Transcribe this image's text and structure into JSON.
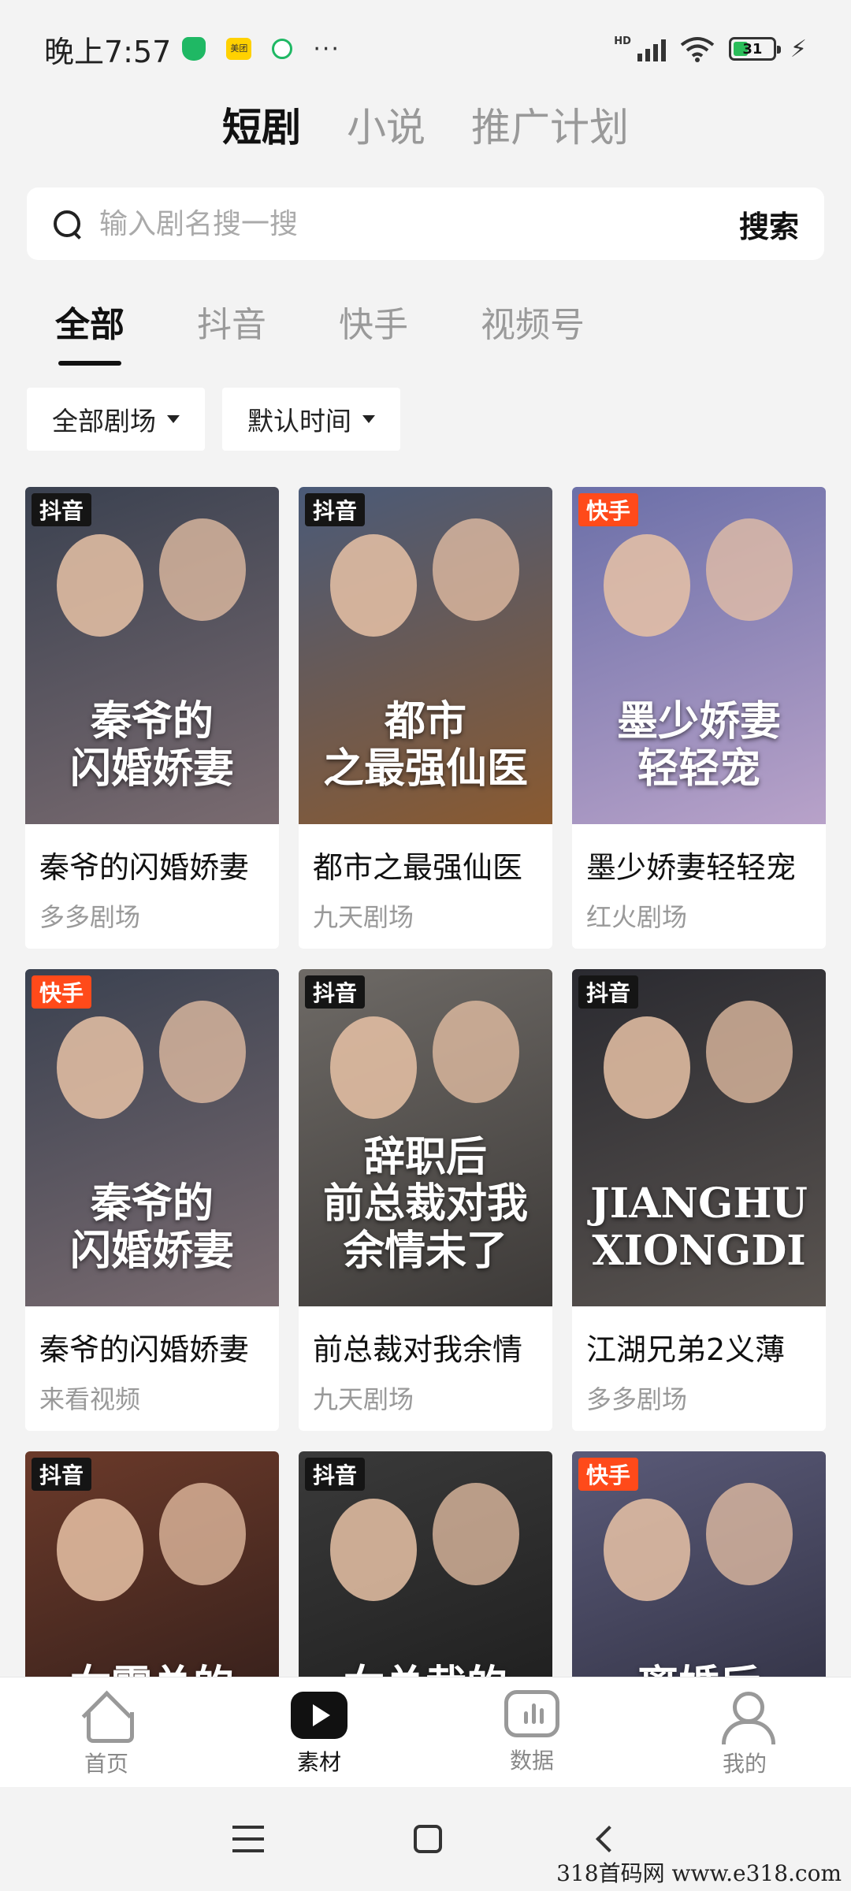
{
  "status_bar": {
    "time": "晚上7:57",
    "meituan_label": "美团",
    "more": "···",
    "network": "HD",
    "battery": "31",
    "charging": "⚡"
  },
  "top_tabs": [
    {
      "label": "短剧",
      "active": true
    },
    {
      "label": "小说",
      "active": false
    },
    {
      "label": "推广计划",
      "active": false
    }
  ],
  "search": {
    "placeholder": "输入剧名搜一搜",
    "button": "搜索"
  },
  "platform_tabs": [
    {
      "label": "全部",
      "active": true
    },
    {
      "label": "抖音",
      "active": false
    },
    {
      "label": "快手",
      "active": false
    },
    {
      "label": "视频号",
      "active": false
    }
  ],
  "filters": [
    {
      "label": "全部剧场"
    },
    {
      "label": "默认时间"
    }
  ],
  "cards": [
    {
      "badge": "抖音",
      "platform": "douyin",
      "title": "秦爷的闪婚娇妻",
      "theater": "多多剧场",
      "poster_text": "秦爷的\n闪婚娇妻",
      "bg": [
        "#3a4150",
        "#7a6b70"
      ]
    },
    {
      "badge": "抖音",
      "platform": "douyin",
      "title": "都市之最强仙医",
      "theater": "九天剧场",
      "poster_text": "都市\n之最强仙医",
      "bg": [
        "#4a5a78",
        "#8a5a30"
      ]
    },
    {
      "badge": "快手",
      "platform": "kuaishou",
      "title": "墨少娇妻轻轻宠",
      "theater": "红火剧场",
      "poster_text": "墨少娇妻\n轻轻宠",
      "bg": [
        "#6b6fa8",
        "#b8a2c9"
      ]
    },
    {
      "badge": "快手",
      "platform": "kuaishou",
      "title": "秦爷的闪婚娇妻",
      "theater": "来看视频",
      "poster_text": "秦爷的\n闪婚娇妻",
      "bg": [
        "#3a4150",
        "#7a6b70"
      ]
    },
    {
      "badge": "抖音",
      "platform": "douyin",
      "title": "前总裁对我余情",
      "theater": "九天剧场",
      "poster_text": "辞职后\n前总裁对我\n余情未了",
      "bg": [
        "#6e6a66",
        "#3d3a38"
      ]
    },
    {
      "badge": "抖音",
      "platform": "douyin",
      "title": "江湖兄弟2义薄",
      "theater": "多多剧场",
      "poster_text": "JIANGHU\nXIONGDI",
      "bg": [
        "#2a2a30",
        "#5a5450"
      ]
    },
    {
      "badge": "抖音",
      "platform": "douyin",
      "title": "",
      "theater": "",
      "poster_text": "女霸总的\n贴身神医",
      "bg": [
        "#6b3a2a",
        "#2a1a18"
      ]
    },
    {
      "badge": "抖音",
      "platform": "douyin",
      "title": "",
      "theater": "",
      "poster_text": "女总裁的\n最强司机",
      "bg": [
        "#3a3a3a",
        "#181818"
      ]
    },
    {
      "badge": "快手",
      "platform": "kuaishou",
      "title": "",
      "theater": "",
      "poster_text": "离婚后\n她后悔了",
      "bg": [
        "#5a5a78",
        "#2a2a3a"
      ]
    }
  ],
  "bottom_nav": [
    {
      "label": "首页",
      "icon": "home-icon",
      "active": false
    },
    {
      "label": "素材",
      "icon": "play-icon",
      "active": true
    },
    {
      "label": "数据",
      "icon": "data-icon",
      "active": false
    },
    {
      "label": "我的",
      "icon": "user-icon",
      "active": false
    }
  ],
  "watermark": "318首码网  www.e318.com"
}
